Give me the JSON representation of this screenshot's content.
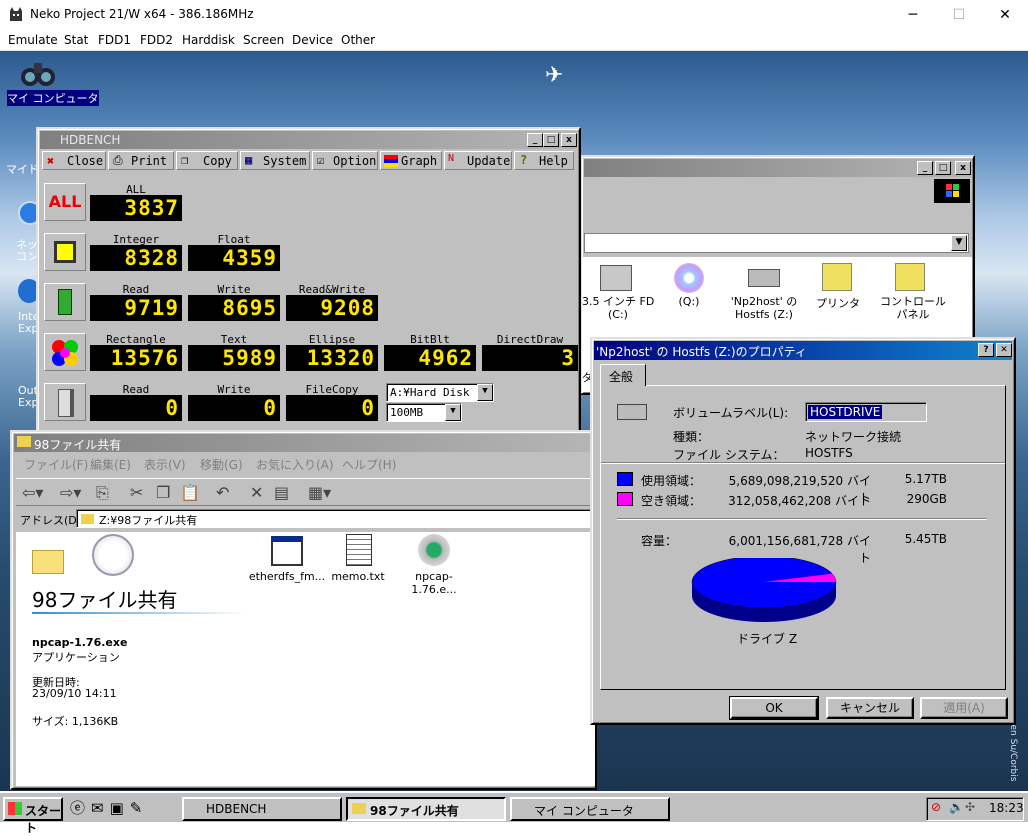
{
  "host": {
    "title": "Neko Project 21/W x64 - 386.186MHz",
    "minimize": "─",
    "maximize": "☐",
    "close": "✕",
    "menu": [
      "Emulate",
      "Stat",
      "FDD1",
      "FDD2",
      "Harddisk",
      "Screen",
      "Device",
      "Other"
    ]
  },
  "desktop_icons": {
    "my_computer": "マイ コンピュータ",
    "my_docs": "マイド",
    "network": "ネット\nコン",
    "ie": "Inte\nExp",
    "outlook": "Out\nExp"
  },
  "hdbench": {
    "title": "HDBENCH",
    "toolbar": {
      "close": "Close",
      "print": "Print",
      "copy": "Copy",
      "system": "System",
      "option": "Option",
      "graph": "Graph",
      "update": "Update",
      "help": "Help"
    },
    "all": {
      "badge": "ALL",
      "label": "ALL",
      "value": "3837"
    },
    "cpu": {
      "integer_label": "Integer",
      "integer": "8328",
      "float_label": "Float",
      "float": "4359"
    },
    "memory": {
      "read_label": "Read",
      "read": "9719",
      "write_label": "Write",
      "write": "8695",
      "rw_label": "Read&Write",
      "rw": "9208"
    },
    "video": {
      "rect_label": "Rectangle",
      "rect": "13576",
      "text_label": "Text",
      "text": "5989",
      "ellipse_label": "Ellipse",
      "ellipse": "13320",
      "bitblt_label": "BitBlt",
      "bitblt": "4962",
      "dd_label": "DirectDraw",
      "dd": "3"
    },
    "disk": {
      "read_label": "Read",
      "read": "0",
      "write_label": "Write",
      "write": "0",
      "copy_label": "FileCopy",
      "copy": "0",
      "drive": "A:¥Hard Disk",
      "size": "100MB"
    }
  },
  "mycomputer": {
    "items": [
      "3.5 インチ FD\n(C:)",
      "(Q:)",
      "'Np2host' の\nHostfs (Z:)",
      "プリンタ",
      "コントロール\nパネル"
    ],
    "cut": "ダ"
  },
  "explorer": {
    "title": "98ファイル共有",
    "menu": [
      "ファイル(F)",
      "編集(E)",
      "表示(V)",
      "移動(G)",
      "お気に入り(A)",
      "ヘルプ(H)"
    ],
    "address_label": "アドレス(D)",
    "address": "Z:¥98ファイル共有",
    "folder_heading": "98ファイル共有",
    "selected_name": "npcap-1.76.exe",
    "selected_type": "アプリケーション",
    "modified_label": "更新日時:",
    "modified": "23/09/10 14:11",
    "size": "サイズ: 1,136KB",
    "files": [
      "etherdfs_fm...",
      "memo.txt",
      "npcap-1.76.e..."
    ]
  },
  "props": {
    "title": "'Np2host' の Hostfs (Z:)のプロパティ",
    "help": "?",
    "close": "✕",
    "tab": "全般",
    "volume_label_key": "ボリュームラベル(L):",
    "volume_label": "HOSTDRIVE",
    "type_key": "種類：",
    "type": "ネットワーク接続",
    "fs_key": "ファイル システム：",
    "fs": "HOSTFS",
    "used_key": "使用領域：",
    "used_bytes": "5,689,098,219,520 バイト",
    "used_hr": "5.17TB",
    "free_key": "空き領域：",
    "free_bytes": "312,058,462,208 バイト",
    "free_hr": "290GB",
    "cap_key": "容量：",
    "cap_bytes": "6,001,156,681,728 バイト",
    "cap_hr": "5.45TB",
    "drive": "ドライブ Z",
    "ok": "OK",
    "cancel": "キャンセル",
    "apply": "適用(A)",
    "used_color": "#0000ff",
    "free_color": "#ff00ff",
    "used_fraction": 0.948
  },
  "taskbar": {
    "start": "スタート",
    "tasks": [
      "HDBENCH",
      "98ファイル共有",
      "マイ コンピュータ"
    ],
    "clock": "18:23"
  },
  "watermark": "ren Su/Corbis"
}
